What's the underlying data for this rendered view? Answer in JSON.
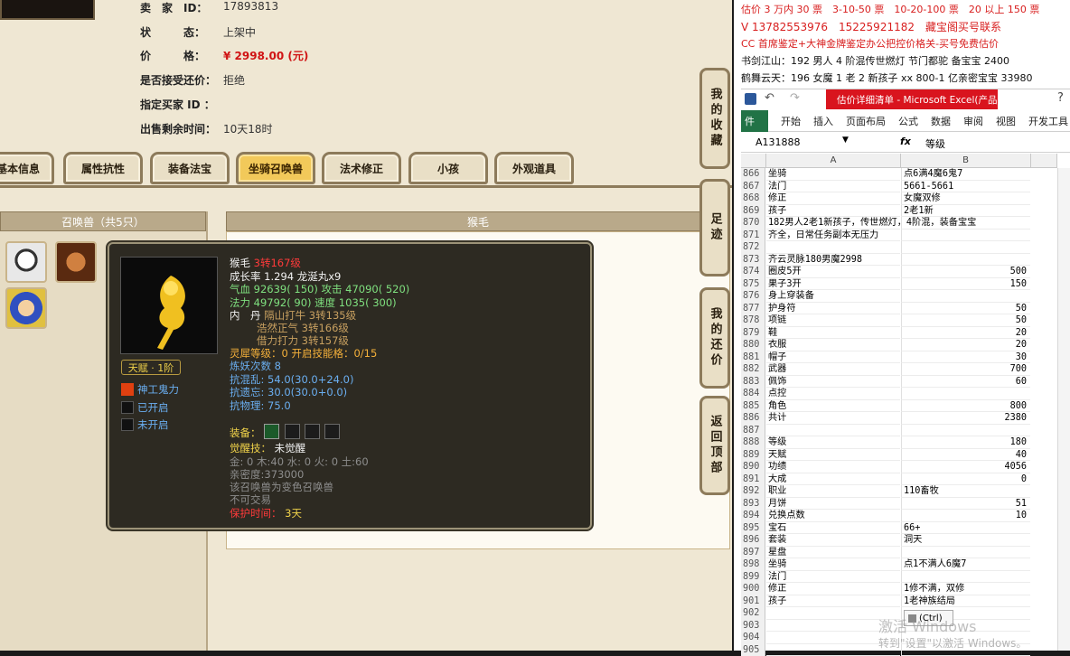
{
  "game": {
    "info": [
      {
        "label": "卖　家　ID：",
        "value": "17893813"
      },
      {
        "label": "状　　　态：",
        "value": "上架中"
      },
      {
        "label": "价　　　格：",
        "value": "¥ 2998.00 (元)"
      },
      {
        "label": "是否接受还价：",
        "value": "拒绝"
      },
      {
        "label": "指定买家 ID ：",
        "value": ""
      },
      {
        "label": "出售剩余时间：",
        "value": "10天18时"
      }
    ],
    "tabs": [
      "基本信息",
      "属性抗性",
      "装备法宝",
      "坐骑召唤兽",
      "法术修正",
      "小孩",
      "外观道具"
    ],
    "active_tab": "坐骑召唤兽",
    "left_panel_title": "召唤兽（共5只）",
    "right_panel_title": "猴毛",
    "side_tabs": [
      "我的收藏",
      "足迹",
      "我的还价",
      "返回顶部"
    ],
    "tooltip": {
      "name": "猴毛",
      "level": "3转167级",
      "growth": "成长率 1.294 龙涎丸x9",
      "hp": "气血 92639( 150) 攻击 47090( 520)",
      "mp": "法力 49792( 90) 速度 1035( 300)",
      "neidan_label": "内　丹",
      "neidan1": "隔山打牛 3转135级",
      "neidan2": "浩然正气 3转166级",
      "neidan3": "借力打力 3转157级",
      "talent": "天赋 · 1阶",
      "lingxi": "灵犀等级：0 开启技能格：0/15",
      "lianyao": "炼妖次数 8",
      "res1": "抗混乱: 54.0(30.0+24.0)",
      "res2": "抗遗忘: 30.0(30.0+0.0)",
      "res3": "抗物理: 75.0",
      "skill1": "神工鬼力",
      "skill2": "已开启",
      "skill3": "未开启",
      "equip_label": "装备：",
      "awaken_label": "觉醒技：",
      "awaken_value": "未觉醒",
      "elements": "金: 0 木:40 水: 0 火: 0 土:60",
      "intimacy": "亲密度:373000",
      "line1": "该召唤兽为变色召唤兽",
      "line2": "不可交易",
      "protect_label": "保护时间：",
      "protect_value": "3天"
    }
  },
  "notes": [
    "估价 3 万内 30 票　3-10-50 票　10-20-100 票　20 以上 150 票",
    "V 13782553976　15225921182　藏宝阁买号联系",
    "CC 首席鉴定+大神金牌鉴定办公把控价格关-买号免费估价",
    "书剑江山：192 男人 4 阶混传世燃灯 节门都驼 备宝宝 2400",
    "鹤舞云天：196 女魔 1 老 2 新孩子 xx 800-1 亿亲密宝宝 33980"
  ],
  "excel": {
    "title": "估价详细清单 - Microsoft Excel(产品激",
    "ribbon": [
      "件",
      "开始",
      "插入",
      "页面布局",
      "公式",
      "数据",
      "审阅",
      "视图",
      "开发工具"
    ],
    "name_box": "A131888",
    "fx": "fx",
    "formula": "等级",
    "col_a": "A",
    "col_b": "B",
    "rows": [
      {
        "n": "866",
        "a": "坐骑",
        "b": "点6满4魔6鬼7"
      },
      {
        "n": "867",
        "a": "法门",
        "b": "5661-5661"
      },
      {
        "n": "868",
        "a": "修正",
        "b": "女魔双修"
      },
      {
        "n": "869",
        "a": "孩子",
        "b": "2老1新"
      },
      {
        "n": "870",
        "a": "182男人2老1新孩子，传世燃灯，4阶混，装备宝宝",
        "b": ""
      },
      {
        "n": "871",
        "a": "齐全，日常任务副本无压力",
        "b": ""
      },
      {
        "n": "872",
        "a": "",
        "b": ""
      },
      {
        "n": "873",
        "a": "齐云灵脉180男魔2998",
        "b": ""
      },
      {
        "n": "874",
        "a": "圈皮5开",
        "b": "500"
      },
      {
        "n": "875",
        "a": "果子3开",
        "b": "150"
      },
      {
        "n": "876",
        "a": "身上穿装备",
        "b": ""
      },
      {
        "n": "877",
        "a": "护身符",
        "b": "50"
      },
      {
        "n": "878",
        "a": "项链",
        "b": "50"
      },
      {
        "n": "879",
        "a": "鞋",
        "b": "20"
      },
      {
        "n": "880",
        "a": "衣服",
        "b": "20"
      },
      {
        "n": "881",
        "a": "帽子",
        "b": "30"
      },
      {
        "n": "882",
        "a": "武器",
        "b": "700"
      },
      {
        "n": "883",
        "a": "佩饰",
        "b": "60"
      },
      {
        "n": "884",
        "a": "点控",
        "b": ""
      },
      {
        "n": "885",
        "a": "角色",
        "b": "800"
      },
      {
        "n": "886",
        "a": "共计",
        "b": "2380"
      },
      {
        "n": "887",
        "a": "",
        "b": ""
      },
      {
        "n": "888",
        "a": "等级",
        "b": "180"
      },
      {
        "n": "889",
        "a": "天赋",
        "b": "40"
      },
      {
        "n": "890",
        "a": "功绩",
        "b": "4056"
      },
      {
        "n": "891",
        "a": "大成",
        "b": "0"
      },
      {
        "n": "892",
        "a": "职业",
        "b": "110畜牧"
      },
      {
        "n": "893",
        "a": "月饼",
        "b": "51"
      },
      {
        "n": "894",
        "a": "兑换点数",
        "b": "10"
      },
      {
        "n": "895",
        "a": "宝石",
        "b": "66+"
      },
      {
        "n": "896",
        "a": "套装",
        "b": "洞天"
      },
      {
        "n": "897",
        "a": "星盘",
        "b": ""
      },
      {
        "n": "898",
        "a": "坐骑",
        "b": "点1不满人6魔7"
      },
      {
        "n": "899",
        "a": "法门",
        "b": ""
      },
      {
        "n": "900",
        "a": "修正",
        "b": "1修不满，双修"
      },
      {
        "n": "901",
        "a": "孩子",
        "b": "1老神族结局"
      },
      {
        "n": "902",
        "a": "",
        "b": ""
      },
      {
        "n": "903",
        "a": "",
        "b": ""
      },
      {
        "n": "904",
        "a": "",
        "b": ""
      },
      {
        "n": "905",
        "a": "",
        "b": ""
      }
    ],
    "ctrl_label": "(Ctrl)",
    "watermark1": "激活 Windows",
    "watermark2": "转到\"设置\"以激活 Windows。"
  }
}
